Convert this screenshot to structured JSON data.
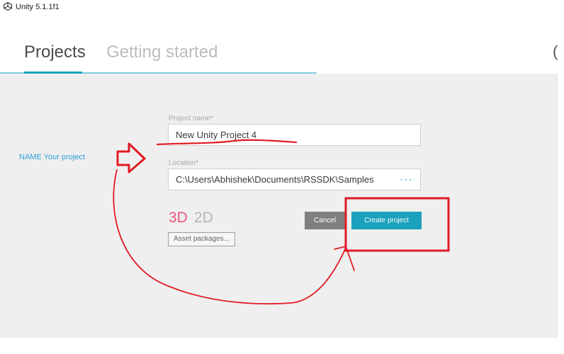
{
  "window": {
    "title": "Unity 5.1.1f1",
    "icon": "unity-logo-icon"
  },
  "tabs": [
    {
      "label": "Projects",
      "active": true
    },
    {
      "label": "Getting started",
      "active": false
    }
  ],
  "form": {
    "project_name_label": "Project name*",
    "project_name_value": "New Unity Project 4",
    "location_label": "Location*",
    "location_value": "C:\\Users\\Abhishek\\Documents\\RSSDK\\Samples",
    "browse_label": "···",
    "mode_3d": "3D",
    "mode_2d": "2D",
    "selected_mode": "3D",
    "asset_packages_label": "Asset packages...",
    "cancel_label": "Cancel",
    "create_label": "Create project"
  },
  "annotation": {
    "note": "NAME Your project",
    "color": "#e01b24"
  },
  "colors": {
    "accent": "#1ba1bd",
    "mode_3d": "#e8577d",
    "cancel_bg": "#7f7f7f",
    "panel_bg": "#efefef"
  }
}
